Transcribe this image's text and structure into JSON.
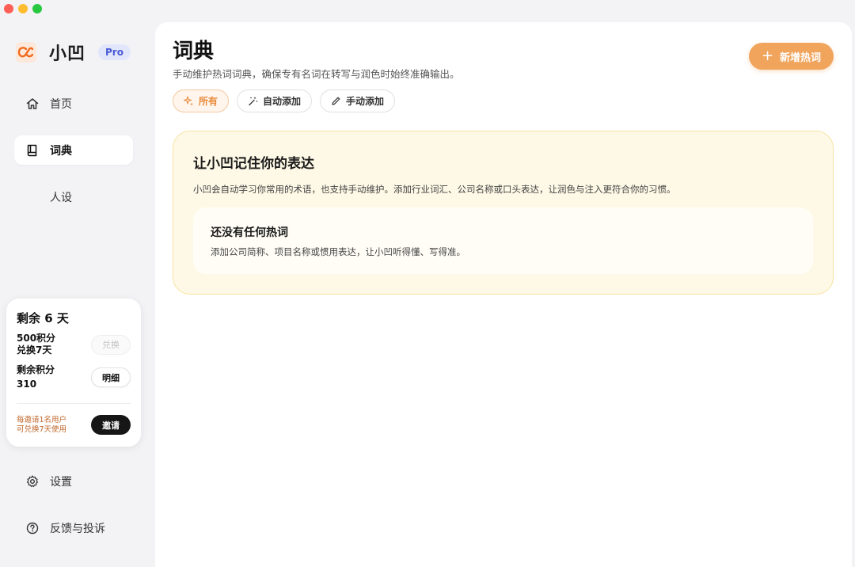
{
  "app": {
    "name": "小凹",
    "tier": "Pro"
  },
  "sidebar": {
    "items": [
      {
        "label": "首页",
        "icon": "home-icon"
      },
      {
        "label": "词典",
        "icon": "book-icon"
      },
      {
        "label": "人设",
        "icon": ""
      }
    ],
    "bottom": [
      {
        "label": "设置",
        "icon": "gear-icon"
      },
      {
        "label": "反馈与投诉",
        "icon": "help-circle-icon"
      }
    ]
  },
  "credits": {
    "title": "剩余 6 天",
    "redeem_line1": "500积分",
    "redeem_line2": "兑换7天",
    "redeem_button": "兑换",
    "remaining_label": "剩余积分",
    "remaining_value": "310",
    "detail_button": "明细",
    "invite_line1": "每邀请1名用户",
    "invite_line2": "可兑换7天使用",
    "invite_button": "邀请"
  },
  "main": {
    "title": "词典",
    "subtitle": "手动维护热词词典，确保专有名词在转写与润色时始终准确输出。",
    "add_button": "新增热词",
    "filters": [
      {
        "label": "所有",
        "icon": "sparkle-icon"
      },
      {
        "label": "自动添加",
        "icon": "magic-wand-icon"
      },
      {
        "label": "手动添加",
        "icon": "pencil-icon"
      }
    ],
    "hero": {
      "title": "让小凹记住你的表达",
      "description": "小凹会自动学习你常用的术语，也支持手动维护。添加行业词汇、公司名称或口头表达，让润色与注入更符合你的习惯。",
      "empty_title": "还没有任何热词",
      "empty_description": "添加公司简称、项目名称或惯用表达，让小凹听得懂、写得准。"
    }
  },
  "colors": {
    "accent": "#f0a45c",
    "pro_badge_bg": "#e2e6fb",
    "hero_bg": "#fef9e6",
    "invite_text": "#c0662a"
  }
}
